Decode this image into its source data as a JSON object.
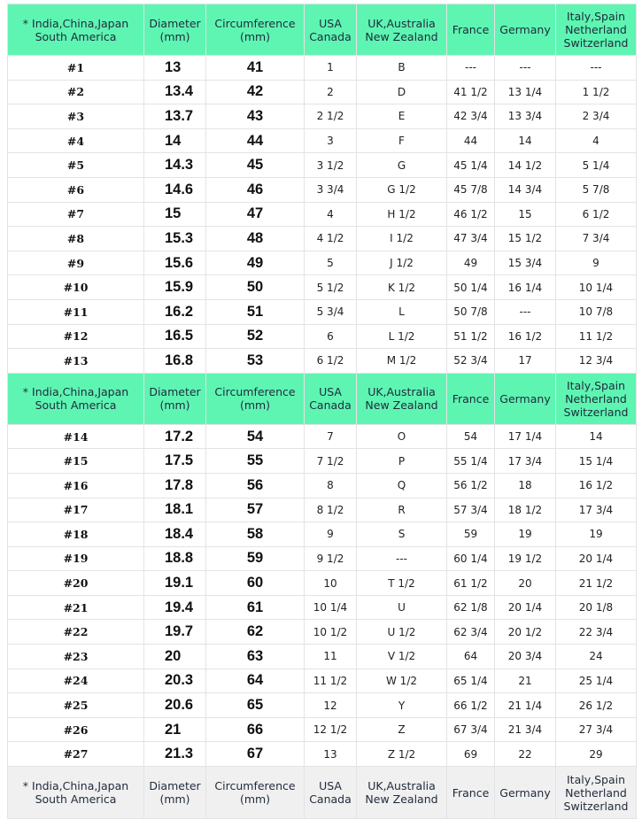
{
  "header": {
    "col1": [
      "* India,China,Japan",
      "South America"
    ],
    "col2": [
      "Diameter",
      "(mm)"
    ],
    "col3": [
      "Circumference",
      "(mm)"
    ],
    "col4": [
      "USA",
      "Canada"
    ],
    "col5": [
      "UK,Australia",
      "New Zealand"
    ],
    "col6": [
      "France"
    ],
    "col7": [
      "Germany"
    ],
    "col8": [
      "Italy,Spain",
      "Netherland",
      "Switzerland"
    ]
  },
  "colors": {
    "header_bg": "#5ef5b3",
    "footer_header_bg": "#f0f0f0",
    "border": "#e3e3e3"
  },
  "rows": [
    {
      "size": "#1",
      "diameter": "13",
      "circumference": "41",
      "usa": "1",
      "uk": "B",
      "france": "---",
      "germany": "---",
      "italy": "---"
    },
    {
      "size": "#2",
      "diameter": "13.4",
      "circumference": "42",
      "usa": "2",
      "uk": "D",
      "france": "41 1/2",
      "germany": "13 1/4",
      "italy": "1 1/2"
    },
    {
      "size": "#3",
      "diameter": "13.7",
      "circumference": "43",
      "usa": "2 1/2",
      "uk": "E",
      "france": "42 3/4",
      "germany": "13 3/4",
      "italy": "2 3/4"
    },
    {
      "size": "#4",
      "diameter": "14",
      "circumference": "44",
      "usa": "3",
      "uk": "F",
      "france": "44",
      "germany": "14",
      "italy": "4"
    },
    {
      "size": "#5",
      "diameter": "14.3",
      "circumference": "45",
      "usa": "3 1/2",
      "uk": "G",
      "france": "45 1/4",
      "germany": "14 1/2",
      "italy": "5 1/4"
    },
    {
      "size": "#6",
      "diameter": "14.6",
      "circumference": "46",
      "usa": "3 3/4",
      "uk": "G 1/2",
      "france": "45 7/8",
      "germany": "14 3/4",
      "italy": "5 7/8"
    },
    {
      "size": "#7",
      "diameter": "15",
      "circumference": "47",
      "usa": "4",
      "uk": "H 1/2",
      "france": "46 1/2",
      "germany": "15",
      "italy": "6 1/2"
    },
    {
      "size": "#8",
      "diameter": "15.3",
      "circumference": "48",
      "usa": "4 1/2",
      "uk": "I 1/2",
      "france": "47 3/4",
      "germany": "15 1/2",
      "italy": "7 3/4"
    },
    {
      "size": "#9",
      "diameter": "15.6",
      "circumference": "49",
      "usa": "5",
      "uk": "J 1/2",
      "france": "49",
      "germany": "15 3/4",
      "italy": "9"
    },
    {
      "size": "#10",
      "diameter": "15.9",
      "circumference": "50",
      "usa": "5 1/2",
      "uk": "K 1/2",
      "france": "50 1/4",
      "germany": "16 1/4",
      "italy": "10 1/4"
    },
    {
      "size": "#11",
      "diameter": "16.2",
      "circumference": "51",
      "usa": "5 3/4",
      "uk": "L",
      "france": "50 7/8",
      "germany": "---",
      "italy": "10 7/8"
    },
    {
      "size": "#12",
      "diameter": "16.5",
      "circumference": "52",
      "usa": "6",
      "uk": "L 1/2",
      "france": "51 1/2",
      "germany": "16 1/2",
      "italy": "11 1/2"
    },
    {
      "size": "#13",
      "diameter": "16.8",
      "circumference": "53",
      "usa": "6 1/2",
      "uk": "M 1/2",
      "france": "52 3/4",
      "germany": "17",
      "italy": "12 3/4"
    },
    {
      "size": "#14",
      "diameter": "17.2",
      "circumference": "54",
      "usa": "7",
      "uk": "O",
      "france": "54",
      "germany": "17 1/4",
      "italy": "14"
    },
    {
      "size": "#15",
      "diameter": "17.5",
      "circumference": "55",
      "usa": "7 1/2",
      "uk": "P",
      "france": "55 1/4",
      "germany": "17 3/4",
      "italy": "15 1/4"
    },
    {
      "size": "#16",
      "diameter": "17.8",
      "circumference": "56",
      "usa": "8",
      "uk": "Q",
      "france": "56 1/2",
      "germany": "18",
      "italy": "16 1/2"
    },
    {
      "size": "#17",
      "diameter": "18.1",
      "circumference": "57",
      "usa": "8 1/2",
      "uk": "R",
      "france": "57 3/4",
      "germany": "18 1/2",
      "italy": "17 3/4"
    },
    {
      "size": "#18",
      "diameter": "18.4",
      "circumference": "58",
      "usa": "9",
      "uk": "S",
      "france": "59",
      "germany": "19",
      "italy": "19"
    },
    {
      "size": "#19",
      "diameter": "18.8",
      "circumference": "59",
      "usa": "9 1/2",
      "uk": "---",
      "france": "60 1/4",
      "germany": "19 1/2",
      "italy": "20 1/4"
    },
    {
      "size": "#20",
      "diameter": "19.1",
      "circumference": "60",
      "usa": "10",
      "uk": "T 1/2",
      "france": "61 1/2",
      "germany": "20",
      "italy": "21 1/2"
    },
    {
      "size": "#21",
      "diameter": "19.4",
      "circumference": "61",
      "usa": "10 1/4",
      "uk": "U",
      "france": "62 1/8",
      "germany": "20 1/4",
      "italy": "20 1/8"
    },
    {
      "size": "#22",
      "diameter": "19.7",
      "circumference": "62",
      "usa": "10 1/2",
      "uk": "U 1/2",
      "france": "62 3/4",
      "germany": "20 1/2",
      "italy": "22 3/4"
    },
    {
      "size": "#23",
      "diameter": "20",
      "circumference": "63",
      "usa": "11",
      "uk": "V 1/2",
      "france": "64",
      "germany": "20 3/4",
      "italy": "24"
    },
    {
      "size": "#24",
      "diameter": "20.3",
      "circumference": "64",
      "usa": "11 1/2",
      "uk": "W 1/2",
      "france": "65 1/4",
      "germany": "21",
      "italy": "25 1/4"
    },
    {
      "size": "#25",
      "diameter": "20.6",
      "circumference": "65",
      "usa": "12",
      "uk": "Y",
      "france": "66 1/2",
      "germany": "21 1/4",
      "italy": "26 1/2"
    },
    {
      "size": "#26",
      "diameter": "21",
      "circumference": "66",
      "usa": "12 1/2",
      "uk": "Z",
      "france": "67 3/4",
      "germany": "21 3/4",
      "italy": "27 3/4"
    },
    {
      "size": "#27",
      "diameter": "21.3",
      "circumference": "67",
      "usa": "13",
      "uk": "Z 1/2",
      "france": "69",
      "germany": "22",
      "italy": "29"
    }
  ],
  "layout_sections": {
    "header_positions": [
      "top",
      "after_row_13",
      "bottom"
    ]
  }
}
